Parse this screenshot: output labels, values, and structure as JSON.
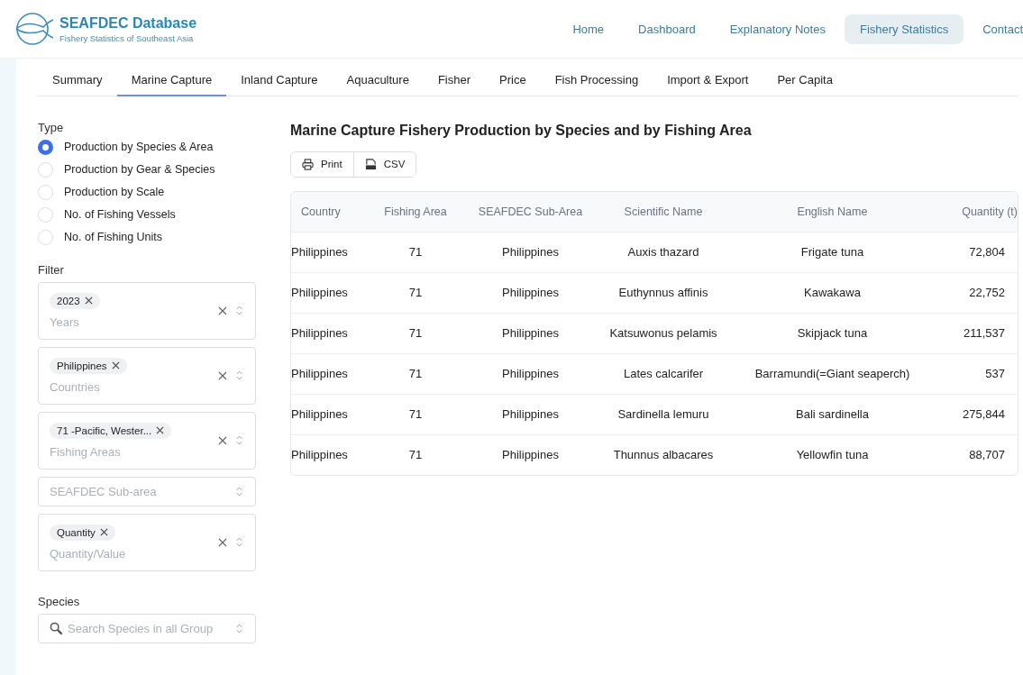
{
  "header": {
    "title": "SEAFDEC Database",
    "subtitle": "Fishery Statistics of Southeast Asia",
    "nav": [
      {
        "label": "Home",
        "selected": false
      },
      {
        "label": "Dashboard",
        "selected": false
      },
      {
        "label": "Explanatory Notes",
        "selected": false
      },
      {
        "label": "Fishery Statistics",
        "selected": true
      },
      {
        "label": "Contact",
        "selected": false
      }
    ]
  },
  "tabs": [
    {
      "label": "Summary",
      "selected": false
    },
    {
      "label": "Marine Capture",
      "selected": true
    },
    {
      "label": "Inland Capture",
      "selected": false
    },
    {
      "label": "Aquaculture",
      "selected": false
    },
    {
      "label": "Fisher",
      "selected": false
    },
    {
      "label": "Price",
      "selected": false
    },
    {
      "label": "Fish Processing",
      "selected": false
    },
    {
      "label": "Import & Export",
      "selected": false
    },
    {
      "label": "Per Capita",
      "selected": false
    }
  ],
  "sidebar": {
    "type_label": "Type",
    "types": [
      {
        "label": "Production by Species & Area",
        "selected": true
      },
      {
        "label": "Production by Gear & Species",
        "selected": false
      },
      {
        "label": "Production by Scale",
        "selected": false
      },
      {
        "label": "No. of Fishing Vessels",
        "selected": false
      },
      {
        "label": "No. of Fishing Units",
        "selected": false
      }
    ],
    "filter_label": "Filter",
    "filters": [
      {
        "chips": [
          "2023"
        ],
        "placeholder": "Years"
      },
      {
        "chips": [
          "Philippines"
        ],
        "placeholder": "Countries"
      },
      {
        "chips": [
          "71 -Pacific, Wester..."
        ],
        "placeholder": "Fishing Areas"
      },
      {
        "placeholder": "SEAFDEC Sub-area"
      },
      {
        "chips": [
          "Quantity"
        ],
        "placeholder": "Quantity/Value"
      }
    ],
    "species_label": "Species",
    "species_search": {
      "placeholder": "Search Species in all Group"
    }
  },
  "main": {
    "title": "Marine Capture Fishery Production by Species and by Fishing Area",
    "actions": [
      {
        "label": "Print",
        "kind": "print"
      },
      {
        "label": "CSV",
        "kind": "csv"
      }
    ],
    "table": {
      "columns": [
        "Country",
        "Fishing Area",
        "SEAFDEC Sub-Area",
        "Scientific Name",
        "English Name",
        "Quantity (t)"
      ],
      "rows": [
        [
          "Philippines",
          "71",
          "Philippines",
          "Auxis thazard",
          "Frigate tuna",
          "72,804"
        ],
        [
          "Philippines",
          "71",
          "Philippines",
          "Euthynnus affinis",
          "Kawakawa",
          "22,752"
        ],
        [
          "Philippines",
          "71",
          "Philippines",
          "Katsuwonus pelamis",
          "Skipjack tuna",
          "211,537"
        ],
        [
          "Philippines",
          "71",
          "Philippines",
          "Lates calcarifer",
          "Barramundi(=Giant seaperch)",
          "537"
        ],
        [
          "Philippines",
          "71",
          "Philippines",
          "Sardinella lemuru",
          "Bali sardinella",
          "275,844"
        ],
        [
          "Philippines",
          "71",
          "Philippines",
          "Thunnus albacares",
          "Yellowfin tuna",
          "88,707"
        ]
      ]
    }
  }
}
